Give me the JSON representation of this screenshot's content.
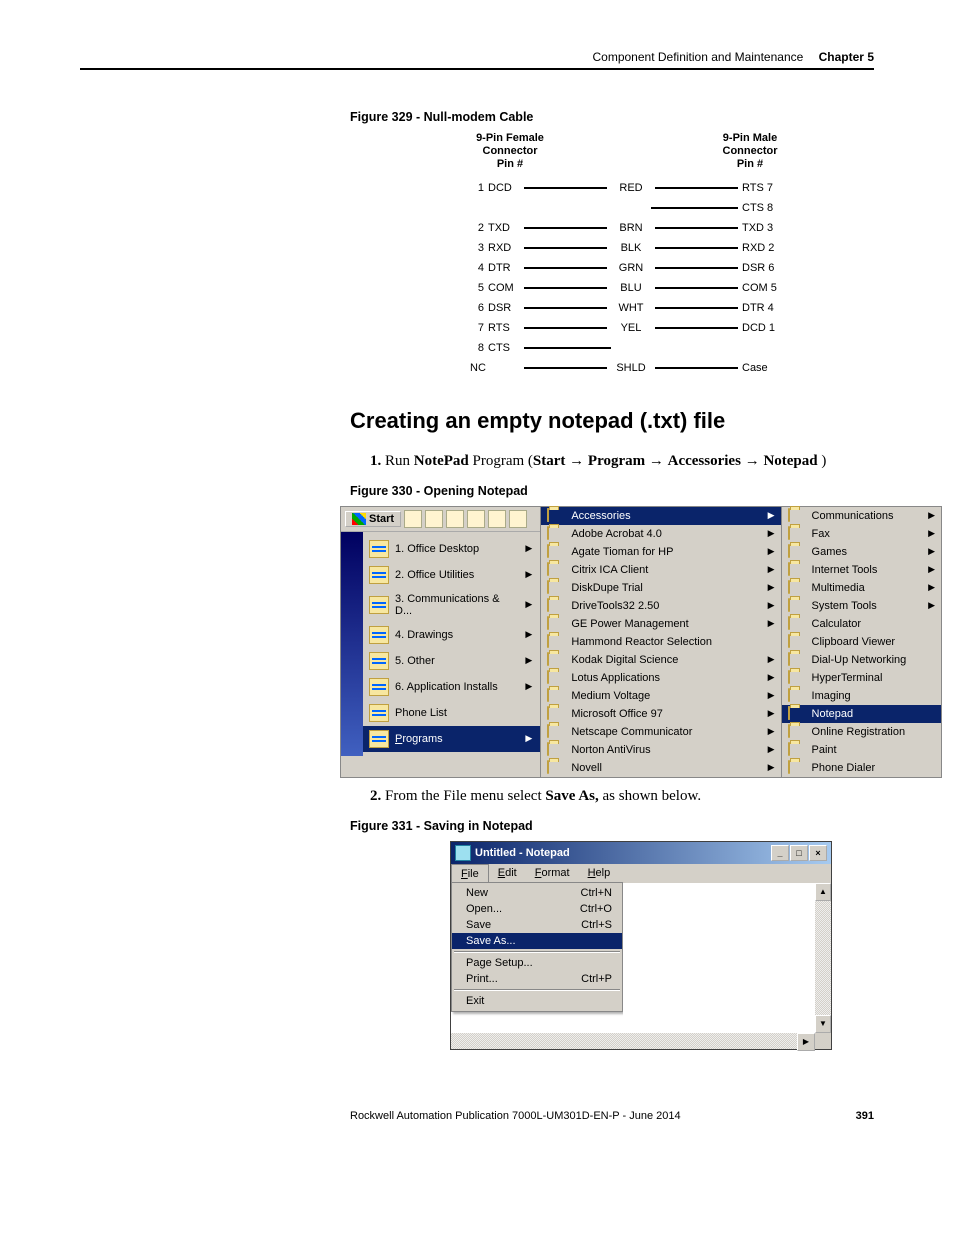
{
  "header": {
    "section": "Component Definition and Maintenance",
    "chapter": "Chapter 5"
  },
  "fig329": {
    "caption": "Figure 329 - Null-modem Cable",
    "left_head": "9-Pin Female\nConnector\nPin #",
    "right_head": "9-Pin Male\nConnector\nPin #",
    "rows": [
      {
        "lp": "1",
        "ls": "DCD",
        "col": "RED",
        "rs": "RTS 7"
      },
      {
        "lp": "",
        "ls": "",
        "col": "",
        "rs": "CTS 8"
      },
      {
        "lp": "2",
        "ls": "TXD",
        "col": "BRN",
        "rs": "TXD 3"
      },
      {
        "lp": "3",
        "ls": "RXD",
        "col": "BLK",
        "rs": "RXD 2"
      },
      {
        "lp": "4",
        "ls": "DTR",
        "col": "GRN",
        "rs": "DSR 6"
      },
      {
        "lp": "5",
        "ls": "COM",
        "col": "BLU",
        "rs": "COM 5"
      },
      {
        "lp": "6",
        "ls": "DSR",
        "col": "WHT",
        "rs": "DTR 4"
      },
      {
        "lp": "7",
        "ls": "RTS",
        "col": "YEL",
        "rs": "DCD 1"
      },
      {
        "lp": "8",
        "ls": "CTS",
        "col": "",
        "rs": ""
      },
      {
        "lp": "NC",
        "ls": "",
        "col": "SHLD",
        "rs": "Case"
      }
    ]
  },
  "section_heading": "Creating an empty notepad (.txt) file",
  "step1": {
    "num": "1.",
    "pre": "Run ",
    "b1": "NotePad",
    "mid": " Program (",
    "path": [
      "Start",
      "Program",
      "Accessories",
      "Notepad"
    ],
    "post": " )"
  },
  "fig330": {
    "caption": "Figure 330 - Opening Notepad",
    "start_label": "Start",
    "left_items": [
      {
        "label": "1. Office Desktop",
        "sub": true
      },
      {
        "label": "2. Office Utilities",
        "sub": true
      },
      {
        "label": "3. Communications & D...",
        "sub": true
      },
      {
        "label": "4. Drawings",
        "sub": true
      },
      {
        "label": "5. Other",
        "sub": true
      },
      {
        "label": "6. Application Installs",
        "sub": true
      },
      {
        "label": "Phone List",
        "sub": false
      },
      {
        "label": "Programs",
        "sub": true,
        "selected": true,
        "underline": "P"
      }
    ],
    "mid_items": [
      {
        "label": "Accessories",
        "sub": true,
        "selected": true
      },
      {
        "label": "Adobe Acrobat 4.0",
        "sub": true
      },
      {
        "label": "Agate Tioman for HP",
        "sub": true
      },
      {
        "label": "Citrix ICA Client",
        "sub": true
      },
      {
        "label": "DiskDupe Trial",
        "sub": true
      },
      {
        "label": "DriveTools32 2.50",
        "sub": true
      },
      {
        "label": "GE Power Management",
        "sub": true
      },
      {
        "label": "Hammond Reactor Selection",
        "sub": false
      },
      {
        "label": "Kodak Digital Science",
        "sub": true
      },
      {
        "label": "Lotus Applications",
        "sub": true
      },
      {
        "label": "Medium Voltage",
        "sub": true
      },
      {
        "label": "Microsoft Office 97",
        "sub": true
      },
      {
        "label": "Netscape Communicator",
        "sub": true
      },
      {
        "label": "Norton AntiVirus",
        "sub": true
      },
      {
        "label": "Novell",
        "sub": true
      }
    ],
    "right_items": [
      {
        "label": "Communications",
        "sub": true
      },
      {
        "label": "Fax",
        "sub": true
      },
      {
        "label": "Games",
        "sub": true
      },
      {
        "label": "Internet Tools",
        "sub": true
      },
      {
        "label": "Multimedia",
        "sub": true
      },
      {
        "label": "System Tools",
        "sub": true
      },
      {
        "label": "Calculator",
        "sub": false
      },
      {
        "label": "Clipboard Viewer",
        "sub": false
      },
      {
        "label": "Dial-Up Networking",
        "sub": false
      },
      {
        "label": "HyperTerminal",
        "sub": false
      },
      {
        "label": "Imaging",
        "sub": false
      },
      {
        "label": "Notepad",
        "sub": false,
        "selected": true
      },
      {
        "label": "Online Registration",
        "sub": false
      },
      {
        "label": "Paint",
        "sub": false
      },
      {
        "label": "Phone Dialer",
        "sub": false
      }
    ]
  },
  "step2": {
    "num": "2.",
    "pre": "From the File menu select ",
    "b1": "Save As,",
    "post": " as shown below."
  },
  "fig331": {
    "caption": "Figure 331 - Saving in Notepad",
    "title": "Untitled - Notepad",
    "menubar": [
      "File",
      "Edit",
      "Format",
      "Help"
    ],
    "file_menu": [
      {
        "label": "New",
        "shortcut": "Ctrl+N"
      },
      {
        "label": "Open...",
        "shortcut": "Ctrl+O"
      },
      {
        "label": "Save",
        "shortcut": "Ctrl+S"
      },
      {
        "label": "Save As...",
        "shortcut": "",
        "selected": true
      },
      {
        "sep": true
      },
      {
        "label": "Page Setup...",
        "shortcut": ""
      },
      {
        "label": "Print...",
        "shortcut": "Ctrl+P"
      },
      {
        "sep": true
      },
      {
        "label": "Exit",
        "shortcut": ""
      }
    ]
  },
  "footer": {
    "pub": "Rockwell Automation Publication 7000L-UM301D-EN-P - June 2014",
    "page": "391"
  }
}
